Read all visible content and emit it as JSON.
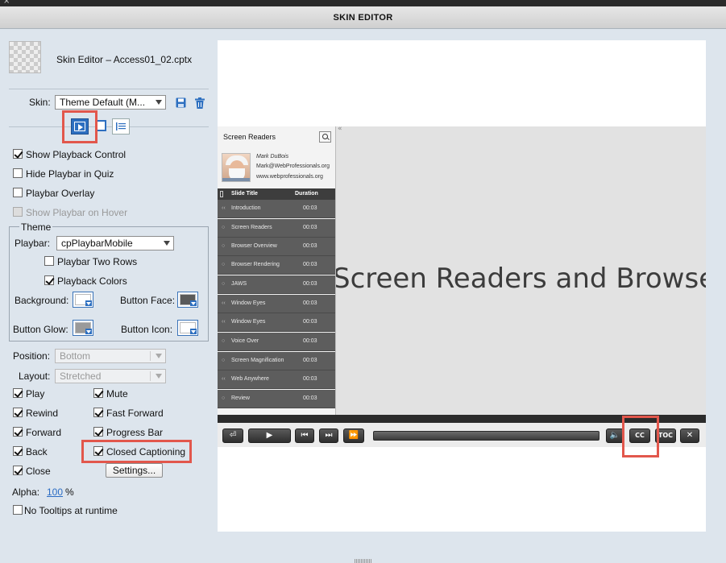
{
  "window": {
    "close_glyph": "×",
    "title": "SKIN EDITOR"
  },
  "file": {
    "name": "Skin Editor – Access01_02.cptx"
  },
  "skin": {
    "label": "Skin:",
    "value": "Theme Default (M...",
    "save_icon": "save-icon",
    "delete_icon": "trash-icon"
  },
  "tabs": [
    {
      "name": "playback-control",
      "icon": "play-icon",
      "selected": true
    },
    {
      "name": "borders",
      "icon": "border-square-icon",
      "selected": false
    },
    {
      "name": "table-of-contents",
      "icon": "toc-list-icon",
      "selected": false
    }
  ],
  "options": {
    "show_playback_control": {
      "label": "Show Playback Control",
      "checked": true
    },
    "hide_playbar_in_quiz": {
      "label": "Hide Playbar in Quiz",
      "checked": false
    },
    "playbar_overlay": {
      "label": "Playbar Overlay",
      "checked": false
    },
    "show_playbar_on_hover": {
      "label": "Show Playbar on Hover",
      "checked": false,
      "disabled": true
    }
  },
  "theme": {
    "legend": "Theme",
    "playbar_label": "Playbar:",
    "playbar_value": "cpPlaybarMobile",
    "two_rows": {
      "label": "Playbar Two Rows",
      "checked": false
    },
    "playback_colors": {
      "label": "Playback Colors",
      "checked": true
    },
    "background_label": "Background:",
    "button_face_label": "Button Face:",
    "button_glow_label": "Button Glow:",
    "button_icon_label": "Button Icon:",
    "colors": {
      "background": "#ffffff",
      "button_face": "#5a5a5a",
      "button_glow": "#9a9a9a",
      "button_icon": "#ffffff"
    }
  },
  "position": {
    "label": "Position:",
    "value": "Bottom"
  },
  "layout": {
    "label": "Layout:",
    "value": "Stretched"
  },
  "controls_left": [
    {
      "label": "Play",
      "checked": true
    },
    {
      "label": "Rewind",
      "checked": true
    },
    {
      "label": "Forward",
      "checked": true
    },
    {
      "label": "Back",
      "checked": true
    },
    {
      "label": "Close",
      "checked": true
    }
  ],
  "controls_right": [
    {
      "label": "Mute",
      "checked": true
    },
    {
      "label": "Fast Forward",
      "checked": true
    },
    {
      "label": "Progress Bar",
      "checked": true
    },
    {
      "label": "Closed Captioning",
      "checked": true
    }
  ],
  "settings_button": "Settings...",
  "alpha": {
    "label": "Alpha:",
    "value": "100",
    "unit": "%"
  },
  "no_tooltips": {
    "label": "No Tooltips at runtime",
    "checked": false
  },
  "preview": {
    "slide_text": "Screen Readers and Browsers",
    "toc": {
      "title": "Screen Readers",
      "author_name": "Mark DuBois",
      "author_email": "Mark@WebProfessionals.org",
      "author_site": "www.webprofessionals.org",
      "header_title": "Slide Title",
      "header_duration": "Duration",
      "rows": [
        {
          "title": "Introduction",
          "duration": "00:03"
        },
        {
          "title": "Screen Readers",
          "duration": "00:03"
        },
        {
          "title": "Browser Overview",
          "duration": "00:03"
        },
        {
          "title": "Browser Rendering",
          "duration": "00:03"
        },
        {
          "title": "JAWS",
          "duration": "00:03"
        },
        {
          "title": "Window Eyes",
          "duration": "00:03"
        },
        {
          "title": "Window Eyes",
          "duration": "00:03"
        },
        {
          "title": "Voice Over",
          "duration": "00:03"
        },
        {
          "title": "Screen Magnification",
          "duration": "00:03"
        },
        {
          "title": "Web Anywhere",
          "duration": "00:03"
        },
        {
          "title": "Review",
          "duration": "00:03"
        }
      ]
    },
    "collapse_glyph": "«",
    "playbar": {
      "exit_glyph": "⏎",
      "play_glyph": "▶",
      "back_glyph": "⏮",
      "forward_glyph": "⏭",
      "fastforward_glyph": "⏩",
      "mute_glyph": "🔈",
      "cc_label": "CC",
      "toc_label": "TOC",
      "close_glyph": "✕"
    }
  },
  "accent_colors": {
    "highlight": "#e2574c",
    "link": "#2b6cc4"
  }
}
